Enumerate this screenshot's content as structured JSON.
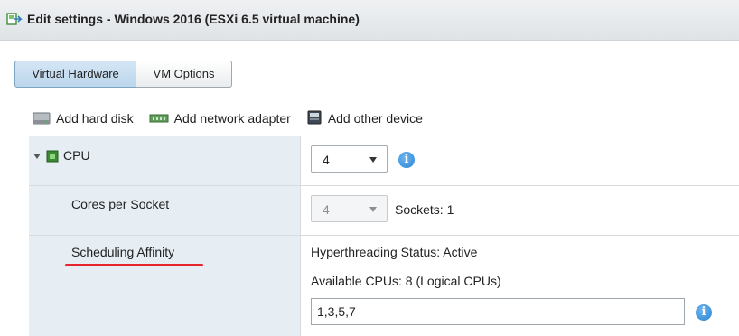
{
  "window": {
    "title": "Edit settings - Windows 2016 (ESXi 6.5 virtual machine)"
  },
  "tabs": [
    {
      "label": "Virtual Hardware",
      "active": true
    },
    {
      "label": "VM Options",
      "active": false
    }
  ],
  "toolbar": {
    "add_hard_disk": "Add hard disk",
    "add_network_adapter": "Add network adapter",
    "add_other_device": "Add other device"
  },
  "cpu": {
    "label": "CPU",
    "value": "4",
    "info_icon": "i"
  },
  "cores": {
    "label": "Cores per Socket",
    "value": "4",
    "sockets_text": "Sockets: 1"
  },
  "affinity": {
    "label": "Scheduling Affinity",
    "hyperthreading": "Hyperthreading Status: Active",
    "available_cpus": "Available CPUs: 8 (Logical CPUs)",
    "value": "1,3,5,7",
    "info_icon": "i"
  },
  "colors": {
    "label_column_bg": "#e6eef4",
    "active_tab": "#c8def1",
    "info_icon": "#3a8fd6",
    "annotation_underline": "#e5262d"
  }
}
